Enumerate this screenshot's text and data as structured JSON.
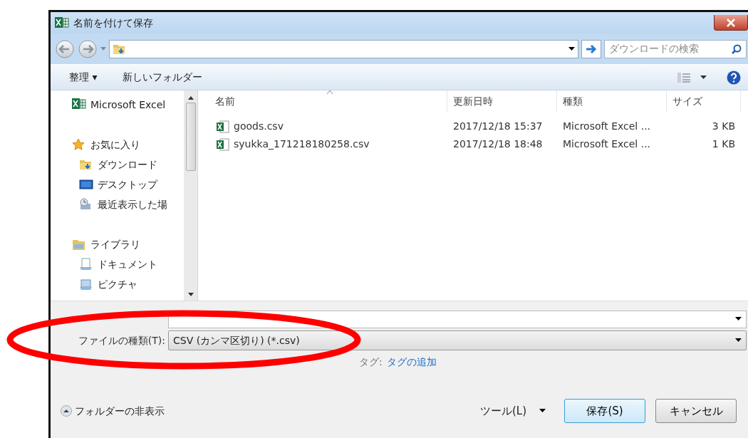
{
  "window": {
    "title": "名前を付けて保存"
  },
  "address_bar": {
    "search_placeholder": "ダウンロードの検索"
  },
  "toolbar": {
    "organize": "整理 ▾",
    "new_folder": "新しいフォルダー"
  },
  "nav_pane": {
    "items": [
      {
        "label": "Microsoft Excel",
        "kind": "app"
      },
      {
        "label": "お気に入り",
        "kind": "favorites",
        "children": [
          {
            "label": "ダウンロード",
            "kind": "download"
          },
          {
            "label": "デスクトップ",
            "kind": "desktop"
          },
          {
            "label": "最近表示した場",
            "kind": "recent"
          }
        ]
      },
      {
        "label": "ライブラリ",
        "kind": "library",
        "children": [
          {
            "label": "ドキュメント",
            "kind": "document"
          },
          {
            "label": "ピクチャ",
            "kind": "pictures"
          }
        ]
      }
    ]
  },
  "table": {
    "columns": [
      {
        "label": "名前",
        "sorted": true
      },
      {
        "label": "更新日時",
        "sorted": false
      },
      {
        "label": "種類",
        "sorted": false
      },
      {
        "label": "サイズ",
        "sorted": false
      }
    ],
    "rows": [
      {
        "name": "goods.csv",
        "modified": "2017/12/18 15:37",
        "type": "Microsoft Excel ...",
        "size": "3 KB"
      },
      {
        "name": "syukka_171218180258.csv",
        "modified": "2017/12/18 18:48",
        "type": "Microsoft Excel ...",
        "size": "1 KB"
      }
    ]
  },
  "save_form": {
    "file_type_label": "ファイルの種類(T):",
    "file_type_value": "CSV (カンマ区切り) (*.csv)",
    "tags_label": "タグ:",
    "tags_link": "タグの追加"
  },
  "footer": {
    "hide_folders": "フォルダーの非表示",
    "tools": "ツール(L)",
    "save": "保存(S)",
    "cancel": "キャンセル"
  }
}
